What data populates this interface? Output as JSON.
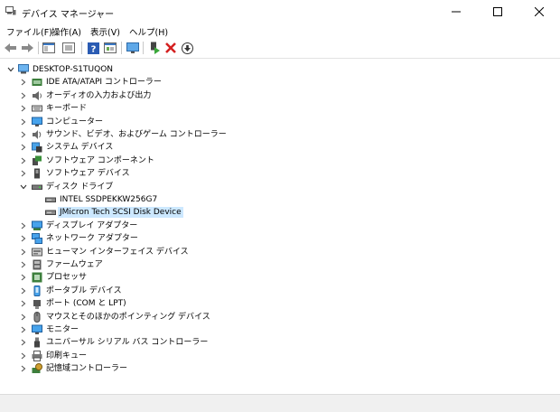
{
  "window": {
    "title": "デバイス マネージャー"
  },
  "menu": [
    "ファイル(F)",
    "操作(A)",
    "表示(V)",
    "ヘルプ(H)"
  ],
  "tree": {
    "root": "DESKTOP-S1TUQON",
    "categories": [
      {
        "label": "IDE ATA/ATAPI コントローラー",
        "icon": "ide-controller-icon"
      },
      {
        "label": "オーディオの入力および出力",
        "icon": "speaker-icon"
      },
      {
        "label": "キーボード",
        "icon": "keyboard-icon"
      },
      {
        "label": "コンピューター",
        "icon": "computer-icon"
      },
      {
        "label": "サウンド、ビデオ、およびゲーム コントローラー",
        "icon": "sound-icon"
      },
      {
        "label": "システム デバイス",
        "icon": "system-device-icon"
      },
      {
        "label": "ソフトウェア コンポーネント",
        "icon": "software-component-icon"
      },
      {
        "label": "ソフトウェア デバイス",
        "icon": "software-device-icon"
      },
      {
        "label": "ディスク ドライブ",
        "icon": "disk-drive-icon",
        "expanded": true,
        "children": [
          {
            "label": "INTEL SSDPEKKW256G7"
          },
          {
            "label": "JMicron Tech SCSI Disk Device",
            "selected": true
          }
        ]
      },
      {
        "label": "ディスプレイ アダプター",
        "icon": "display-adapter-icon"
      },
      {
        "label": "ネットワーク アダプター",
        "icon": "network-adapter-icon"
      },
      {
        "label": "ヒューマン インターフェイス デバイス",
        "icon": "hid-icon"
      },
      {
        "label": "ファームウェア",
        "icon": "firmware-icon"
      },
      {
        "label": "プロセッサ",
        "icon": "processor-icon"
      },
      {
        "label": "ポータブル デバイス",
        "icon": "portable-device-icon"
      },
      {
        "label": "ポート (COM と LPT)",
        "icon": "port-icon"
      },
      {
        "label": "マウスとそのほかのポインティング デバイス",
        "icon": "mouse-icon"
      },
      {
        "label": "モニター",
        "icon": "monitor-icon"
      },
      {
        "label": "ユニバーサル シリアル バス コントローラー",
        "icon": "usb-icon"
      },
      {
        "label": "印刷キュー",
        "icon": "printer-icon"
      },
      {
        "label": "記憶域コントローラー",
        "icon": "storage-controller-icon"
      }
    ]
  }
}
